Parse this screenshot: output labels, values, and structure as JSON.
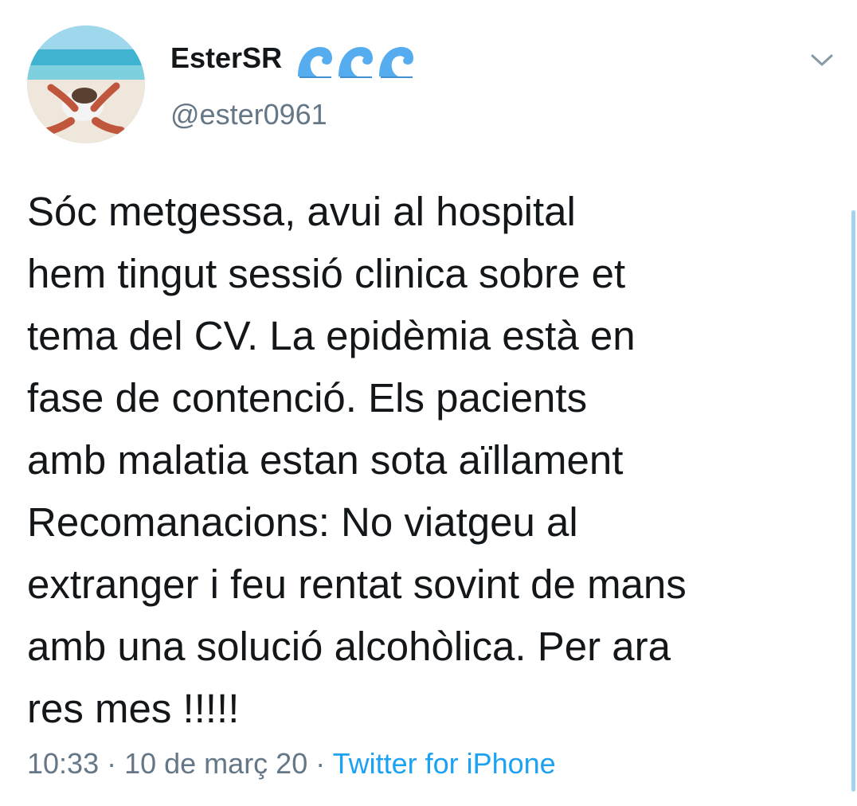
{
  "tweet": {
    "display_name": "EsterSR",
    "name_emojis": [
      "wave-icon",
      "wave-icon",
      "wave-icon"
    ],
    "handle": "@ester0961",
    "text": "Sóc metgessa, avui al hospital\nhem tingut sessió clinica sobre et\ntema del CV. La epidèmia està en\nfase de contenció. Els pacients\namb malatia estan sota aïllament\nRecomanacions: No viatgeu al\nextranger i feu rentat sovint de mans\namb una solució alcohòlica. Per ara\nres mes !!!!!",
    "time": "10:33",
    "separator": " · ",
    "date": "10 de març 20",
    "source": "Twitter for iPhone"
  },
  "icons": {
    "menu": "chevron-down-icon",
    "avatar": "beach-photo"
  },
  "colors": {
    "text": "#14171a",
    "secondary": "#657786",
    "link": "#1da1f2",
    "wave": "#55acee",
    "scrollbar": "#a3d4ef"
  }
}
